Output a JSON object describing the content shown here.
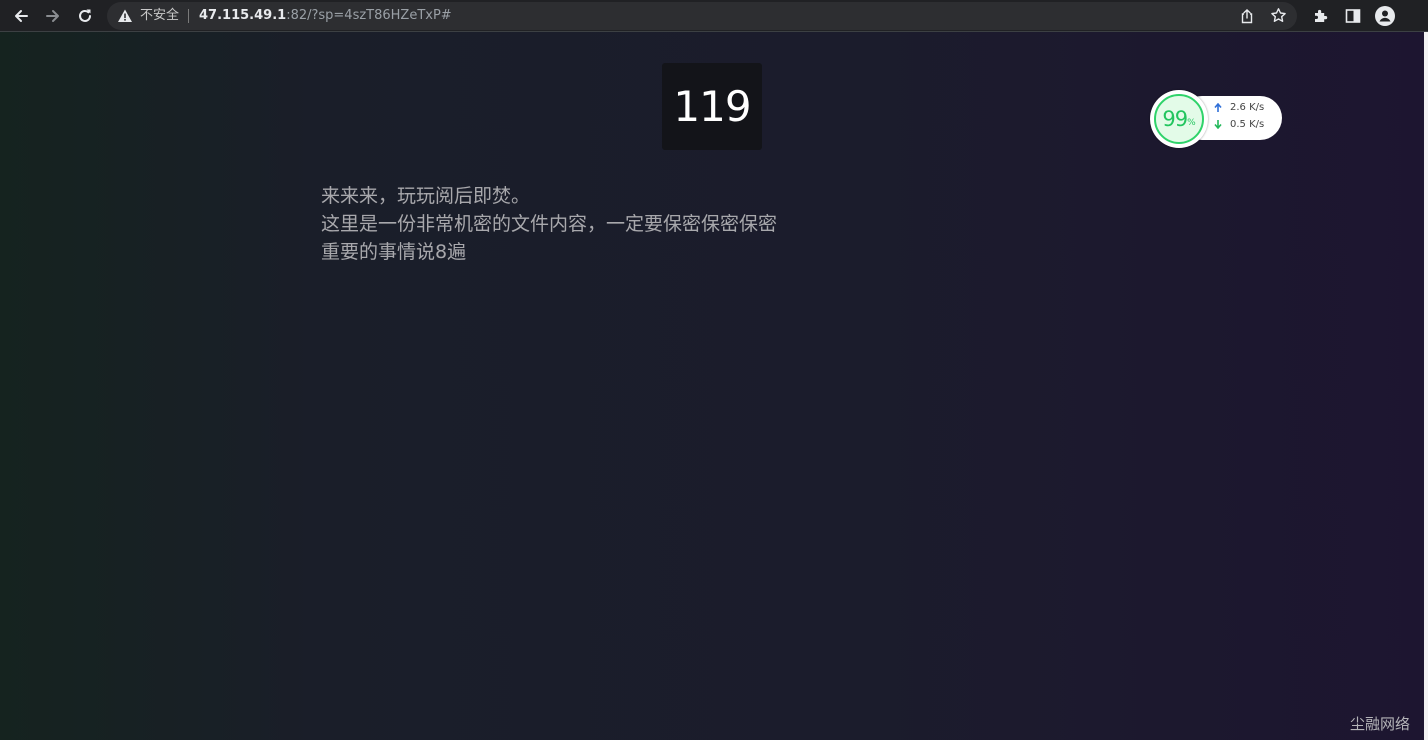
{
  "browser": {
    "security_label": "不安全",
    "url_host": "47.115.49.1",
    "url_rest": ":82/?sp=4szT86HZeTxP#",
    "icons": {
      "back": "arrow-left-icon",
      "forward": "arrow-right-icon",
      "reload": "reload-icon",
      "warning": "warning-triangle-icon",
      "share": "share-icon",
      "bookmark": "star-icon",
      "extensions": "puzzle-icon",
      "side_panel": "side-panel-icon",
      "profile": "profile-icon"
    }
  },
  "page": {
    "counter": "119",
    "message_lines": [
      "来来来，玩玩阅后即焚。",
      "这里是一份非常机密的文件内容，一定要保密保密保密",
      "重要的事情说8遍"
    ],
    "brand": "尘融网络"
  },
  "speed_widget": {
    "percent": "99",
    "percent_unit": "%",
    "upload": "2.6 K/s",
    "download": "0.5 K/s",
    "colors": {
      "ring": "#2fd36a",
      "upload_arrow": "#2f6fd8",
      "download_arrow": "#22b85a"
    }
  }
}
